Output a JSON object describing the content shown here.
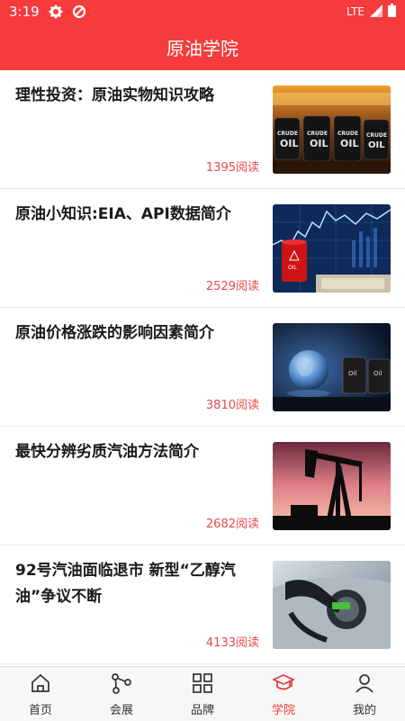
{
  "status_bar": {
    "time": "3:19",
    "network": "LTE",
    "icons": [
      "gear-icon",
      "data-saver-icon",
      "signal-icon",
      "battery-icon"
    ]
  },
  "header": {
    "title": "原油学院"
  },
  "theme": {
    "accent": "#f53b3b",
    "reads_color": "#e84a4a",
    "active_tab_color": "#e83a3a"
  },
  "articles": [
    {
      "title": "理性投资：原油实物知识攻略",
      "reads": "1395阅读",
      "image": "crude-oil-barrels-image"
    },
    {
      "title": "原油小知识:EIA、API数据简介",
      "reads": "2529阅读",
      "image": "oil-barrel-stock-chart-image"
    },
    {
      "title": "原油价格涨跌的影响因素简介",
      "reads": "3810阅读",
      "image": "globe-oil-barrels-image"
    },
    {
      "title": "最快分辨劣质汽油方法简介",
      "reads": "2682阅读",
      "image": "oil-pumpjack-sunset-image"
    },
    {
      "title": "92号汽油面临退市 新型“乙醇汽油”争议不断",
      "reads": "4133阅读",
      "image": "fuel-nozzle-car-image"
    }
  ],
  "bottom_nav": {
    "tabs": [
      {
        "label": "首页",
        "icon": "home-icon",
        "active": false
      },
      {
        "label": "会展",
        "icon": "share-nodes-icon",
        "active": false
      },
      {
        "label": "品牌",
        "icon": "grid-icon",
        "active": false
      },
      {
        "label": "学院",
        "icon": "graduation-cap-icon",
        "active": true
      },
      {
        "label": "我的",
        "icon": "user-icon",
        "active": false
      }
    ]
  }
}
